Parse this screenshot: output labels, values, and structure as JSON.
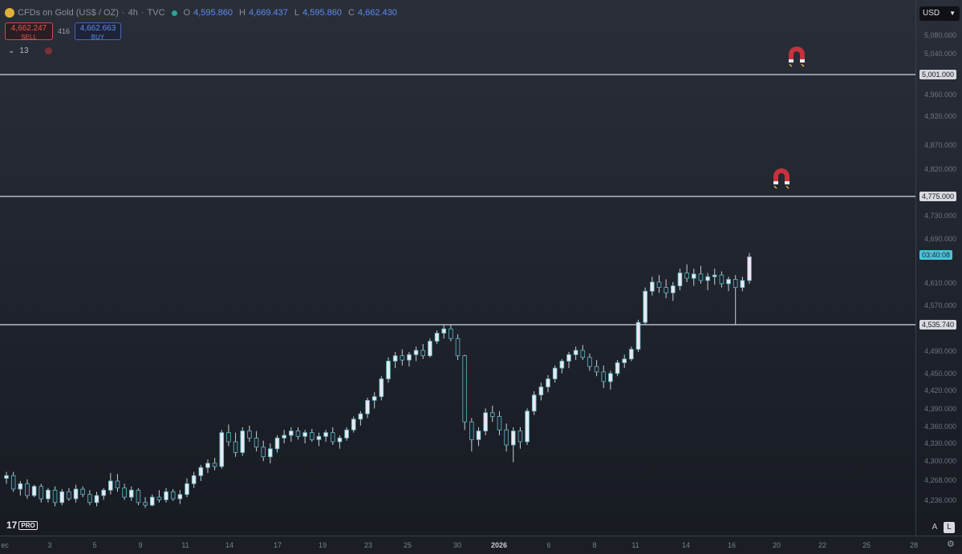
{
  "symbol": {
    "name": "CFDs on Gold (US$ / OZ)",
    "timeframe": "4h",
    "source": "TVC",
    "ohlc": [
      {
        "label": "O",
        "value": "4,595.860"
      },
      {
        "label": "H",
        "value": "4,669.437"
      },
      {
        "label": "L",
        "value": "4,595.860"
      },
      {
        "label": "C",
        "value": "4,662.430"
      }
    ]
  },
  "trade": {
    "sell_price": "4,662.247",
    "sell_label": "SELL",
    "spread": "416",
    "buy_price": "4,662.663",
    "buy_label": "BUY"
  },
  "indicators": {
    "count": "13"
  },
  "currency": "USD",
  "colors": {
    "background": "#1f232c",
    "candle_up": "#e8e9ee",
    "candle_down": "#e8e9ee",
    "candle_outline": "#5fb8c8",
    "level_line": "#d6d8de",
    "timer": "#4cc3d9",
    "magnet_red": "#c8323c"
  },
  "icons": [
    "magnet-icon",
    "magnet-icon",
    "chevron-down-icon",
    "settings-icon"
  ],
  "price_axis": {
    "ticks": [
      "5,080.000",
      "5,040.000",
      "4,960.000",
      "4,920.000",
      "4,870.000",
      "4,820.000",
      "4,730.000",
      "4,690.000",
      "4,610.000",
      "4,570.000",
      "4,490.000",
      "4,450.000",
      "4,420.000",
      "4,390.000",
      "4,360.000",
      "4,330.000",
      "4,300.000",
      "4,268.000",
      "4,236.000"
    ],
    "levels": [
      "5,001.000",
      "4,775.000",
      "4,535.740"
    ],
    "countdown": "03:40:08"
  },
  "time_axis": {
    "labels": [
      "ec",
      "3",
      "5",
      "9",
      "11",
      "14",
      "17",
      "19",
      "23",
      "25",
      "30",
      "2026",
      "6",
      "8",
      "11",
      "14",
      "16",
      "20",
      "22",
      "25",
      "28"
    ]
  },
  "chart_data": {
    "type": "candlestick",
    "interval": "4h",
    "horizontal_levels": [
      5001.0,
      4775.0,
      4535.74
    ],
    "ylim": [
      4195,
      5110
    ],
    "candles": [
      [
        4250,
        4262,
        4240,
        4255
      ],
      [
        4255,
        4262,
        4225,
        4230
      ],
      [
        4230,
        4245,
        4218,
        4240
      ],
      [
        4240,
        4248,
        4212,
        4218
      ],
      [
        4218,
        4238,
        4215,
        4235
      ],
      [
        4235,
        4240,
        4205,
        4212
      ],
      [
        4212,
        4232,
        4205,
        4228
      ],
      [
        4228,
        4235,
        4198,
        4205
      ],
      [
        4205,
        4230,
        4200,
        4225
      ],
      [
        4225,
        4232,
        4208,
        4212
      ],
      [
        4212,
        4238,
        4205,
        4230
      ],
      [
        4230,
        4235,
        4215,
        4220
      ],
      [
        4220,
        4228,
        4200,
        4205
      ],
      [
        4205,
        4225,
        4198,
        4218
      ],
      [
        4218,
        4232,
        4210,
        4228
      ],
      [
        4228,
        4260,
        4220,
        4245
      ],
      [
        4245,
        4258,
        4225,
        4232
      ],
      [
        4232,
        4240,
        4210,
        4215
      ],
      [
        4215,
        4235,
        4208,
        4228
      ],
      [
        4228,
        4232,
        4200,
        4205
      ],
      [
        4205,
        4215,
        4195,
        4200
      ],
      [
        4200,
        4220,
        4198,
        4215
      ],
      [
        4215,
        4228,
        4205,
        4210
      ],
      [
        4210,
        4232,
        4205,
        4225
      ],
      [
        4225,
        4230,
        4208,
        4212
      ],
      [
        4212,
        4228,
        4202,
        4220
      ],
      [
        4220,
        4250,
        4215,
        4240
      ],
      [
        4240,
        4262,
        4232,
        4255
      ],
      [
        4255,
        4275,
        4245,
        4270
      ],
      [
        4270,
        4285,
        4260,
        4278
      ],
      [
        4278,
        4288,
        4265,
        4272
      ],
      [
        4272,
        4340,
        4268,
        4335
      ],
      [
        4335,
        4350,
        4310,
        4318
      ],
      [
        4318,
        4335,
        4290,
        4298
      ],
      [
        4298,
        4345,
        4292,
        4338
      ],
      [
        4338,
        4348,
        4318,
        4325
      ],
      [
        4325,
        4338,
        4300,
        4308
      ],
      [
        4308,
        4320,
        4282,
        4290
      ],
      [
        4290,
        4315,
        4278,
        4305
      ],
      [
        4305,
        4330,
        4298,
        4325
      ],
      [
        4325,
        4340,
        4315,
        4330
      ],
      [
        4330,
        4345,
        4318,
        4338
      ],
      [
        4338,
        4345,
        4322,
        4328
      ],
      [
        4328,
        4340,
        4315,
        4335
      ],
      [
        4335,
        4342,
        4318,
        4322
      ],
      [
        4322,
        4335,
        4310,
        4328
      ],
      [
        4328,
        4340,
        4318,
        4335
      ],
      [
        4335,
        4345,
        4312,
        4318
      ],
      [
        4318,
        4330,
        4305,
        4325
      ],
      [
        4325,
        4345,
        4320,
        4340
      ],
      [
        4340,
        4365,
        4335,
        4360
      ],
      [
        4360,
        4375,
        4348,
        4370
      ],
      [
        4370,
        4400,
        4362,
        4395
      ],
      [
        4395,
        4410,
        4380,
        4402
      ],
      [
        4402,
        4440,
        4395,
        4435
      ],
      [
        4435,
        4475,
        4428,
        4468
      ],
      [
        4468,
        4485,
        4455,
        4478
      ],
      [
        4478,
        4490,
        4460,
        4470
      ],
      [
        4470,
        4485,
        4458,
        4480
      ],
      [
        4480,
        4495,
        4468,
        4488
      ],
      [
        4488,
        4500,
        4472,
        4478
      ],
      [
        4478,
        4510,
        4475,
        4505
      ],
      [
        4505,
        4525,
        4500,
        4520
      ],
      [
        4520,
        4535,
        4510,
        4528
      ],
      [
        4528,
        4535,
        4505,
        4510
      ],
      [
        4510,
        4518,
        4470,
        4478
      ],
      [
        4478,
        4480,
        4340,
        4355
      ],
      [
        4355,
        4362,
        4300,
        4322
      ],
      [
        4322,
        4345,
        4310,
        4338
      ],
      [
        4338,
        4380,
        4330,
        4372
      ],
      [
        4372,
        4385,
        4355,
        4365
      ],
      [
        4365,
        4375,
        4330,
        4340
      ],
      [
        4340,
        4352,
        4300,
        4312
      ],
      [
        4312,
        4345,
        4280,
        4338
      ],
      [
        4338,
        4345,
        4305,
        4318
      ],
      [
        4318,
        4380,
        4312,
        4375
      ],
      [
        4375,
        4412,
        4368,
        4405
      ],
      [
        4405,
        4428,
        4395,
        4420
      ],
      [
        4420,
        4442,
        4410,
        4435
      ],
      [
        4435,
        4460,
        4428,
        4455
      ],
      [
        4455,
        4472,
        4445,
        4468
      ],
      [
        4468,
        4485,
        4455,
        4480
      ],
      [
        4480,
        4495,
        4470,
        4488
      ],
      [
        4488,
        4498,
        4470,
        4475
      ],
      [
        4475,
        4482,
        4450,
        4458
      ],
      [
        4458,
        4470,
        4440,
        4448
      ],
      [
        4448,
        4460,
        4418,
        4430
      ],
      [
        4430,
        4450,
        4415,
        4445
      ],
      [
        4445,
        4470,
        4440,
        4465
      ],
      [
        4465,
        4480,
        4455,
        4472
      ],
      [
        4472,
        4495,
        4468,
        4490
      ],
      [
        4490,
        4545,
        4485,
        4540
      ],
      [
        4540,
        4605,
        4535,
        4598
      ],
      [
        4598,
        4625,
        4590,
        4615
      ],
      [
        4615,
        4628,
        4595,
        4605
      ],
      [
        4605,
        4620,
        4585,
        4595
      ],
      [
        4595,
        4615,
        4580,
        4608
      ],
      [
        4608,
        4640,
        4600,
        4632
      ],
      [
        4632,
        4648,
        4615,
        4622
      ],
      [
        4622,
        4640,
        4608,
        4630
      ],
      [
        4630,
        4645,
        4612,
        4618
      ],
      [
        4618,
        4632,
        4600,
        4625
      ],
      [
        4625,
        4640,
        4610,
        4628
      ],
      [
        4628,
        4635,
        4605,
        4612
      ],
      [
        4612,
        4625,
        4598,
        4620
      ],
      [
        4620,
        4628,
        4535,
        4605
      ],
      [
        4605,
        4625,
        4598,
        4618
      ],
      [
        4618,
        4669,
        4612,
        4662
      ]
    ]
  }
}
